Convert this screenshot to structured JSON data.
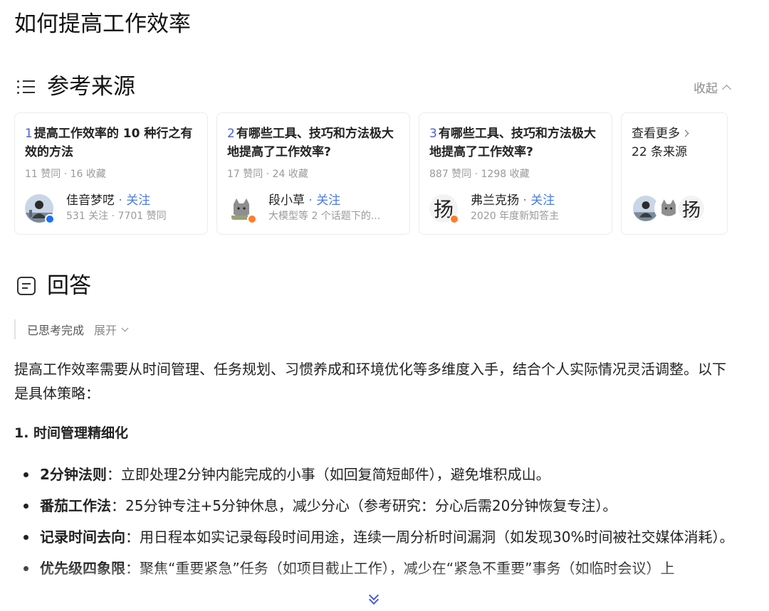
{
  "page_title": "如何提高工作效率",
  "sources": {
    "heading": "参考来源",
    "collapse_label": "收起",
    "cards": [
      {
        "num": "1",
        "title": "提高工作效率的 10 种行之有效的方法",
        "meta": "11 赞同 · 16 收藏",
        "author": "佳音梦呓",
        "follow": " · 关注",
        "desc": "531 关注 · 7701 赞同"
      },
      {
        "num": "2",
        "title": "有哪些工具、技巧和方法极大地提高了工作效率?",
        "meta": "17 赞同 · 24 收藏",
        "author": "段小草",
        "follow": " · 关注",
        "desc": "大模型等 2 个话题下的..."
      },
      {
        "num": "3",
        "title": "有哪些工具、技巧和方法极大地提高了工作效率?",
        "meta": "887 赞同 · 1298 收藏",
        "author": "弗兰克扬",
        "follow": " · 关注",
        "desc": "2020 年度新知答主",
        "avatar_char": "扬"
      }
    ],
    "more": {
      "line1": "查看更多",
      "line2": "22 条来源",
      "avatar_char": "扬"
    }
  },
  "answer": {
    "heading": "回答",
    "thinking_status": "已思考完成",
    "expand_label": "展开",
    "intro": "提高工作效率需要从时间管理、任务规划、习惯养成和环境优化等多维度入手，结合个人实际情况灵活调整。以下是具体策略：",
    "section1_title": "1. 时间管理精细化",
    "bullets": [
      {
        "term": "2分钟法则",
        "text": "：立即处理2分钟内能完成的小事（如回复简短邮件），避免堆积成山。"
      },
      {
        "term": "番茄工作法",
        "text": "：25分钟专注+5分钟休息，减少分心（参考研究：分心后需20分钟恢复专注）。"
      },
      {
        "term": "记录时间去向",
        "text": "：用日程本如实记录每段时间用途，连续一周分析时间漏洞（如发现30%时间被社交媒体消耗）。"
      },
      {
        "term": "优先级四象限",
        "text": "：聚焦“重要紧急”任务（如项目截止工作），减少在“紧急不重要”事务（如临时会议）上"
      }
    ]
  },
  "colors": {
    "accent": "#4a5fd9",
    "follow": "#4a7be0",
    "badge_blue": "#1772f6",
    "badge_orange": "#ff7d2a"
  }
}
